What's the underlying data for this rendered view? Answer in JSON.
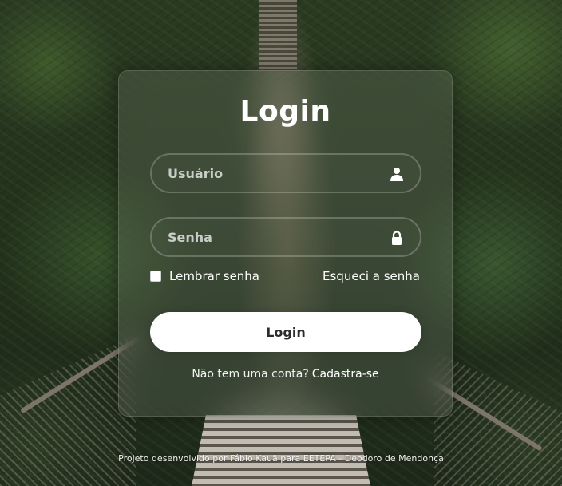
{
  "login_card": {
    "title": "Login",
    "username": {
      "placeholder": "Usuário",
      "value": "",
      "icon": "user-icon"
    },
    "password": {
      "placeholder": "Senha",
      "value": "",
      "icon": "lock-icon"
    },
    "remember": {
      "label": "Lembrar senha",
      "checked": false
    },
    "forgot_link": "Esqueci a senha",
    "submit_label": "Login",
    "signup_prompt": "Não tem uma conta?",
    "signup_link": "Cadastra-se"
  },
  "footer": {
    "text": "Projeto desenvolvido por Fábio Kauã para EETEPA - Deodoro de Mendonça"
  },
  "colors": {
    "button_bg": "#ffffff",
    "button_text": "#2d2d2d",
    "text": "#ffffff"
  }
}
